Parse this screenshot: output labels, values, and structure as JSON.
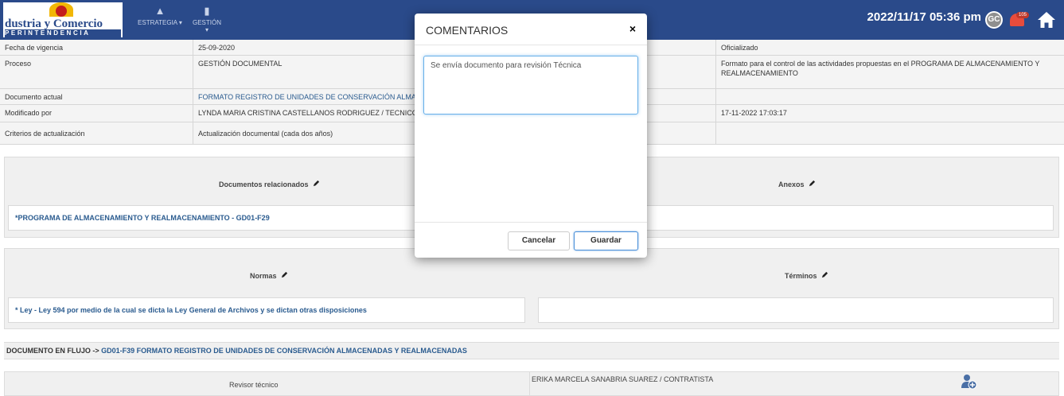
{
  "header": {
    "logo_line1": "dustria y Comercio",
    "logo_line2": "PERINTENDENCIA",
    "nav": [
      {
        "label": "ESTRATEGIA ▾",
        "icon": "bar-chart-icon"
      },
      {
        "label": "GESTIÓN ▾",
        "icon": "document-icon"
      }
    ],
    "datetime": "2022/11/17 05:36 pm",
    "user_initials": "GC",
    "notification_count": "105"
  },
  "fields": [
    {
      "label": "Fecha de vigencia",
      "value": "25-09-2020",
      "right": "Oficializado"
    },
    {
      "label": "Proceso",
      "value": "GESTIÓN DOCUMENTAL",
      "right": "Formato para el control de las actividades propuestas en el PROGRAMA DE ALMACENAMIENTO Y REALMACENAMIENTO"
    },
    {
      "label": "Documento actual",
      "value": "FORMATO REGISTRO DE UNIDADES DE CONSERVACIÓN ALMAC",
      "right": ""
    },
    {
      "label": "Modificado por",
      "value": "LYNDA MARIA CRISTINA CASTELLANOS RODRIGUEZ / TECNICO",
      "right": "17-11-2022 17:03:17"
    },
    {
      "label": "Criterios de actualización",
      "value": "Actualización documental (cada dos años)",
      "right": ""
    }
  ],
  "panels": {
    "docs_title": "Documentos relacionados",
    "docs_item": "*PROGRAMA DE ALMACENAMIENTO Y REALMACENAMIENTO - GD01-F29",
    "anexos_title": "Anexos",
    "normas_title": "Normas",
    "normas_item": "* Ley - Ley 594 por medio de la cual se dicta la Ley General de Archivos y se dictan otras disposiciones",
    "terminos_title": "Términos"
  },
  "flow": {
    "prefix": "DOCUMENTO EN FLUJO ->",
    "link": "GD01-F39 FORMATO REGISTRO DE UNIDADES DE CONSERVACIÓN ALMACENADAS Y REALMACENADAS"
  },
  "reviewer": {
    "label": "Revisor técnico",
    "name": "ERIKA MARCELA SANABRIA SUAREZ / CONTRATISTA"
  },
  "modal": {
    "title": "COMENTARIOS",
    "close": "×",
    "comment": "Se envía documento para revisión Técnica",
    "cancel": "Cancelar",
    "save": "Guardar"
  },
  "colors": {
    "header": "#2a4a8a",
    "link": "#2a5b8f",
    "focus": "#66afe9"
  }
}
